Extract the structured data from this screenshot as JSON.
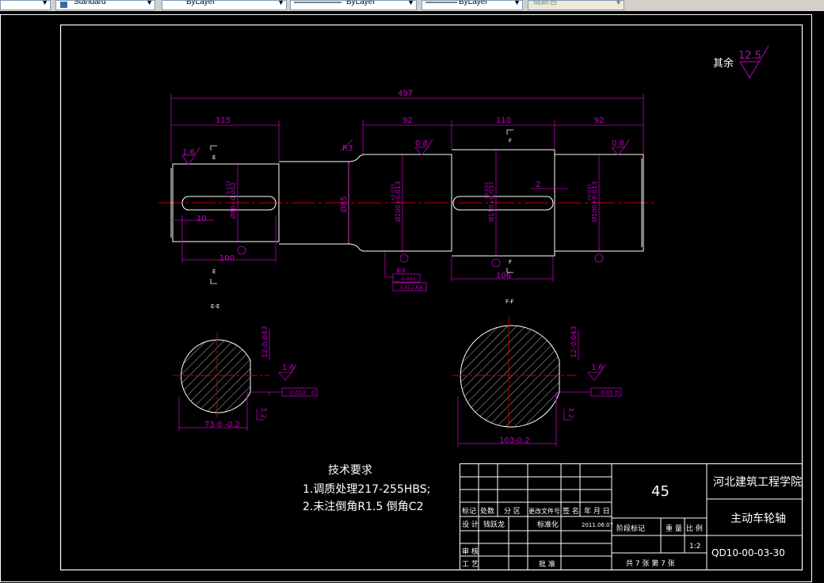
{
  "toolbar": {
    "text_style": "Standard",
    "layer": "ByLayer",
    "linetype": "ByLayer",
    "lineweight": "ByLayer",
    "plot_style": "随颜色"
  },
  "drawing": {
    "surface_rest": "其余",
    "surface_rest_value": "12.5",
    "dims": {
      "total": "497",
      "d115": "115",
      "d92a": "92",
      "d110": "110",
      "d92b": "92",
      "r3": "R3",
      "d10": "10",
      "d100": "100",
      "d106": "106",
      "d2": "2",
      "phi85": "Ø85",
      "phi80": "Ø80+0.002",
      "phi80_up": "+0.015",
      "phi100a": "Ø100+0.013",
      "phi100a_up": "+0.035",
      "phi110": "Ø110+0.037",
      "phi110_up": "+0.059",
      "phi100b": "Ø100+0.013",
      "phi100b_up": "+0.035"
    },
    "rough": {
      "r16a": "1.6",
      "r08a": "0.8",
      "r08b": "0.8",
      "r16b": "1.6",
      "r16c": "1.6",
      "r32a": "3.2",
      "r32b": "3.2"
    },
    "section_marks": {
      "e_top": "E",
      "e_bottom": "E",
      "f_top": "F",
      "f_bottom": "F",
      "ee": "E-E",
      "ff": "F-F"
    },
    "gdt": {
      "tol1": "0.007",
      "tol2": "0.012",
      "ref": "A-B",
      "tol3": "0.012",
      "ref3": "C",
      "tol4": "0.01",
      "ref4": "D",
      "note": "要求"
    },
    "section_dims": {
      "ee_width": "12-0.043",
      "ee_depth": "73  0 -0.2",
      "ff_width": "12-0.043",
      "ff_depth": "103-0.2"
    },
    "tech": {
      "title": "技术要求",
      "line1": "1.调质处理217-255HBS;",
      "line2": "2.未注倒角R1.5  倒角C2"
    },
    "title_block": {
      "material": "45",
      "school": "河北建筑工程学院",
      "part_name": "主动车轮轴",
      "drawing_no": "QD10-00-03-30",
      "scale": "1:2",
      "hdr_mark": "标记",
      "hdr_count": "处数",
      "hdr_zone": "分 区",
      "hdr_doc": "更改文件号",
      "hdr_sign": "签 名",
      "hdr_date": "年 月 日",
      "design": "设 计",
      "designer": "钱跃龙",
      "standard": "标准化",
      "design_date": "2011.06.07",
      "stage": "阶段标记",
      "weight": "重 量",
      "ratio": "比 例",
      "review": "审 核",
      "process": "工 艺",
      "approve": "批 准",
      "sheets": "共 7 张  第 7 张"
    }
  }
}
